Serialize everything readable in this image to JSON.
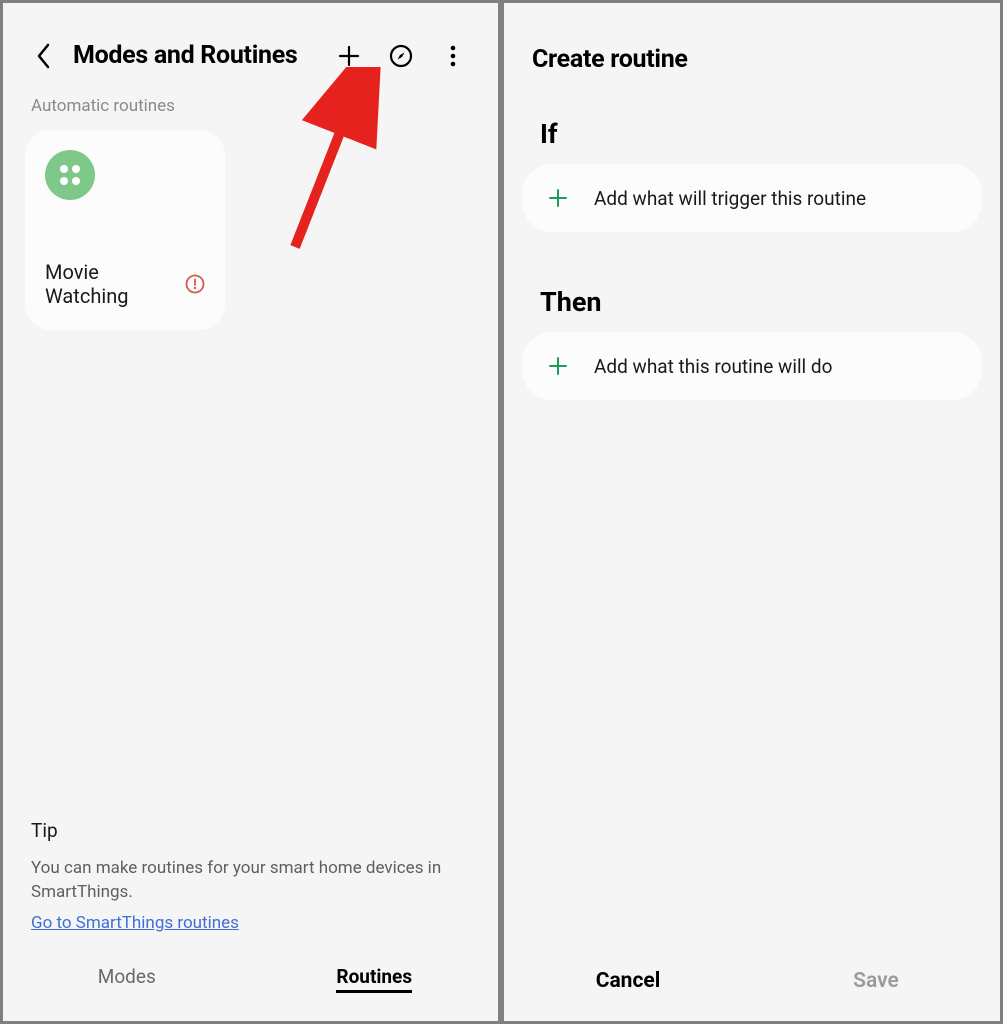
{
  "left": {
    "title": "Modes and Routines",
    "section_label": "Automatic routines",
    "routine": {
      "name": "Movie Watching"
    },
    "tip": {
      "heading": "Tip",
      "body": "You can make routines for your smart home devices in SmartThings.",
      "link": "Go to SmartThings routines"
    },
    "tabs": {
      "modes": "Modes",
      "routines": "Routines",
      "active": "routines"
    }
  },
  "right": {
    "title": "Create routine",
    "if": {
      "heading": "If",
      "add": "Add what will trigger this routine"
    },
    "then": {
      "heading": "Then",
      "add": "Add what this routine will do"
    },
    "footer": {
      "cancel": "Cancel",
      "save": "Save"
    }
  },
  "colors": {
    "accent_green": "#1f9d55",
    "routine_icon_bg": "#7ec98a",
    "link": "#3f6fd6",
    "alert": "#d15c4a",
    "arrow": "#e6221e"
  }
}
